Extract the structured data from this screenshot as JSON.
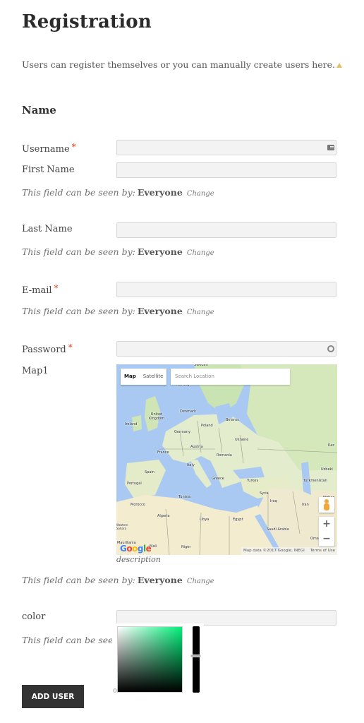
{
  "page": {
    "title": "Registration",
    "intro": "Users can register themselves or you can manually create users here.",
    "section_title": "Name"
  },
  "visibility": {
    "prefix": "This field can be seen by:",
    "prefix_truncated": "This field can be seen",
    "value": "Everyone",
    "change_label": "Change"
  },
  "fields": {
    "username": {
      "label": "Username",
      "required": "*",
      "value": "",
      "icon": "contact-card-icon"
    },
    "first_name": {
      "label": "First Name",
      "value": ""
    },
    "last_name": {
      "label": "Last Name",
      "value": ""
    },
    "email": {
      "label": "E-mail",
      "required": "*",
      "value": ""
    },
    "password": {
      "label": "Password",
      "required": "*",
      "value": "",
      "icon": "key-icon"
    },
    "map": {
      "label": "Map1",
      "description": "description"
    },
    "color": {
      "label": "color",
      "value": ""
    }
  },
  "map": {
    "type_map": "Map",
    "type_satellite": "Satellite",
    "search_placeholder": "Search Location",
    "zoom_in": "+",
    "zoom_out": "−",
    "attribution": "Map data ©2017 Google, INEGI",
    "terms": "Terms of Use",
    "logo": [
      "G",
      "o",
      "o",
      "g",
      "l",
      "e"
    ],
    "logo_colors": [
      "#4285f4",
      "#ea4335",
      "#fbbc05",
      "#4285f4",
      "#34a853",
      "#ea4335"
    ],
    "labels": [
      "Sweden",
      "Norway",
      "Denmark",
      "United Kingdom",
      "Ireland",
      "Germany",
      "Poland",
      "Belarus",
      "Ukraine",
      "Kaz",
      "Austria",
      "France",
      "Romania",
      "Italy",
      "Spain",
      "Portugal",
      "Greece",
      "Turkey",
      "Uzbeki",
      "Turkmenistan",
      "Syria",
      "Iraq",
      "Iran",
      "Afghan",
      "Tunisia",
      "Morocco",
      "Algeria",
      "Libya",
      "Egypt",
      "Saudi Arabia",
      "Western Sahara",
      "Mauritania",
      "Mali",
      "Niger",
      "Oman"
    ]
  },
  "color_picker": {
    "hue_color": "#00f07a"
  },
  "actions": {
    "add_user": "ADD USER"
  }
}
